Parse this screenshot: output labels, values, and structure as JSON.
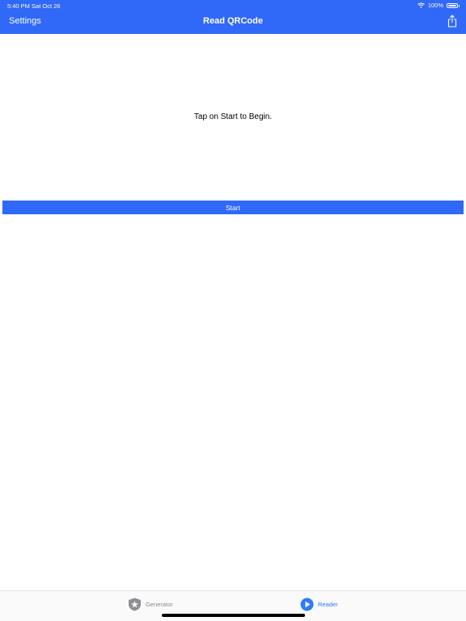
{
  "status_bar": {
    "time": "5:40 PM   Sat Oct 26",
    "battery": "100%",
    "wifi_icon": "wifi-icon",
    "battery_icon": "battery-icon"
  },
  "nav": {
    "left_label": "Settings",
    "title": "Read QRCode",
    "share_icon": "share-icon"
  },
  "main": {
    "prompt": "Tap on Start to Begin.",
    "start_label": "Start"
  },
  "tabbar": {
    "tabs": [
      {
        "label": "Generator",
        "icon": "star-shield-icon",
        "selected": false
      },
      {
        "label": "Reader",
        "icon": "play-circle-icon",
        "selected": true
      }
    ]
  },
  "colors": {
    "accent": "#3068f8",
    "tab_selected": "#2f7cf6",
    "tab_unselected": "#8e8e93"
  }
}
